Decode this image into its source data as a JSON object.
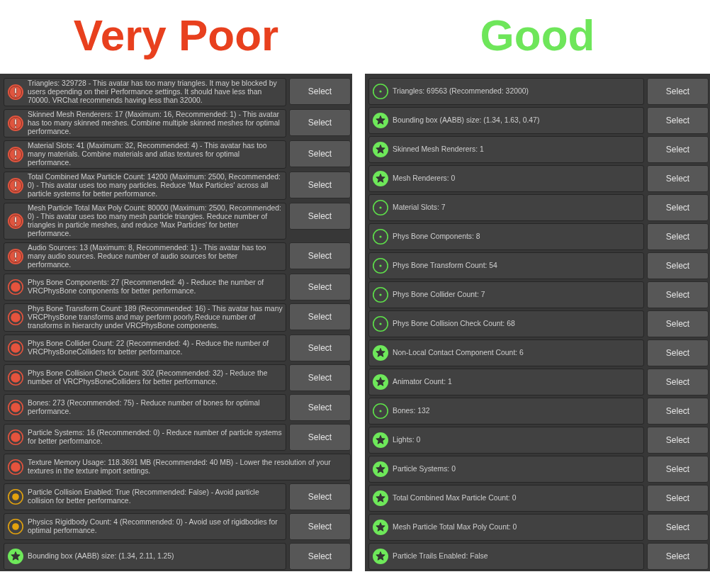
{
  "panels": [
    {
      "heading": "Very Poor",
      "color": "#e8401e",
      "items": [
        {
          "kind": "error",
          "text": "Triangles: 329728 - This avatar has too many triangles. It may be blocked by users depending on their Performance settings. It should have less than 70000. VRChat recommends having less than 32000.",
          "button": "Select"
        },
        {
          "kind": "error",
          "text": "Skinned Mesh Renderers: 17 (Maximum: 16, Recommended: 1) - This avatar has too many skinned meshes. Combine multiple skinned meshes for optimal performance.",
          "button": "Select"
        },
        {
          "kind": "error",
          "text": "Material Slots: 41 (Maximum: 32, Recommended: 4) - This avatar has too many materials. Combine materials and atlas textures for optimal performance.",
          "button": "Select"
        },
        {
          "kind": "error",
          "text": "Total Combined Max Particle Count: 14200 (Maximum: 2500, Recommended: 0) - This avatar uses too many particles. Reduce 'Max Particles' across all particle systems for better performance.",
          "button": "Select"
        },
        {
          "kind": "error",
          "text": "Mesh Particle Total Max Poly Count: 80000 (Maximum: 2500, Recommended: 0) - This avatar uses too many mesh particle triangles. Reduce number of triangles in particle meshes, and reduce 'Max Particles' for better performance.",
          "button": "Select"
        },
        {
          "kind": "error",
          "text": "Audio Sources: 13 (Maximum: 8, Recommended: 1) - This avatar has too many audio sources. Reduce number of audio sources for better performance.",
          "button": "Select"
        },
        {
          "kind": "very_poor",
          "text": "Phys Bone Components: 27 (Recommended: 4) - Reduce the number of VRCPhysBone components for better performance.",
          "button": "Select"
        },
        {
          "kind": "very_poor",
          "text": "Phys Bone Transform Count: 189 (Recommended: 16) - This avatar has many VRCPhysBone transforms and may perform poorly.Reduce number of transforms in hierarchy under VRCPhysBone components.",
          "button": "Select"
        },
        {
          "kind": "very_poor",
          "text": "Phys Bone Collider Count: 22 (Recommended: 4) - Reduce the number of VRCPhysBoneColliders for better performance.",
          "button": "Select"
        },
        {
          "kind": "very_poor",
          "text": "Phys Bone Collision Check Count: 302 (Recommended: 32) - Reduce the number of VRCPhysBoneColliders for better performance.",
          "button": "Select"
        },
        {
          "kind": "very_poor",
          "text": "Bones: 273 (Recommended: 75) - Reduce number of bones for optimal performance.",
          "button": "Select"
        },
        {
          "kind": "very_poor",
          "text": "Particle Systems: 16 (Recommended: 0) - Reduce number of particle systems for better performance.",
          "button": "Select"
        },
        {
          "kind": "very_poor",
          "text": "Texture Memory Usage: 118.3691 MB (Recommended: 40 MB) - Lower the resolution of your textures in the texture import settings."
        },
        {
          "kind": "medium",
          "text": "Particle Collision Enabled: True (Recommended: False) - Avoid particle collision for better performance.",
          "button": "Select"
        },
        {
          "kind": "medium",
          "text": "Physics Rigidbody Count: 4 (Recommended: 0) - Avoid use of rigidbodies for optimal performance.",
          "button": "Select"
        },
        {
          "kind": "excellent",
          "text": "Bounding box (AABB) size: (1.34, 2.11, 1.25)",
          "button": "Select"
        }
      ]
    },
    {
      "heading": "Good",
      "color": "#6ee65a",
      "items": [
        {
          "kind": "good",
          "text": "Triangles: 69563 (Recommended: 32000)",
          "button": "Select"
        },
        {
          "kind": "excellent",
          "text": "Bounding box (AABB) size: (1.34, 1.63, 0.47)",
          "button": "Select"
        },
        {
          "kind": "excellent",
          "text": "Skinned Mesh Renderers: 1",
          "button": "Select"
        },
        {
          "kind": "excellent",
          "text": "Mesh Renderers: 0",
          "button": "Select"
        },
        {
          "kind": "good",
          "text": "Material Slots: 7",
          "button": "Select"
        },
        {
          "kind": "good",
          "text": "Phys Bone Components: 8",
          "button": "Select"
        },
        {
          "kind": "good",
          "text": "Phys Bone Transform Count: 54",
          "button": "Select"
        },
        {
          "kind": "good",
          "text": "Phys Bone Collider Count: 7",
          "button": "Select"
        },
        {
          "kind": "good",
          "text": "Phys Bone Collision Check Count: 68",
          "button": "Select"
        },
        {
          "kind": "excellent",
          "text": "Non-Local Contact Component Count: 6",
          "button": "Select"
        },
        {
          "kind": "excellent",
          "text": "Animator Count: 1",
          "button": "Select"
        },
        {
          "kind": "good",
          "text": "Bones: 132",
          "button": "Select"
        },
        {
          "kind": "excellent",
          "text": "Lights: 0",
          "button": "Select"
        },
        {
          "kind": "excellent",
          "text": "Particle Systems: 0",
          "button": "Select"
        },
        {
          "kind": "excellent",
          "text": "Total Combined Max Particle Count: 0",
          "button": "Select"
        },
        {
          "kind": "excellent",
          "text": "Mesh Particle Total Max Poly Count: 0",
          "button": "Select"
        },
        {
          "kind": "excellent",
          "text": "Particle Trails Enabled: False",
          "button": "Select"
        }
      ]
    }
  ]
}
